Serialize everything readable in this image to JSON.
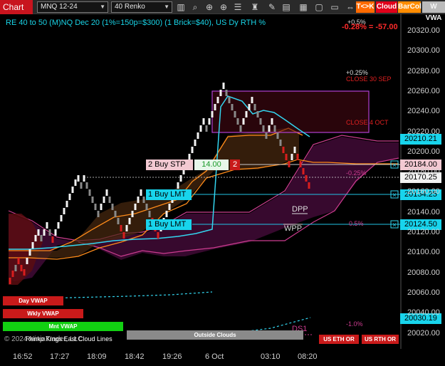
{
  "toolbar": {
    "chart_tab": "Chart",
    "instrument": "MNQ 12-24",
    "bar_type": "40 Renko",
    "icons": [
      "bars-icon",
      "magnify-icon",
      "zoom-icon",
      "properties-icon",
      "strategy-icon",
      "drawing-icon",
      "bar-chart-icon",
      "grid-icon",
      "reload-icon",
      "left-right-icon"
    ],
    "tk_button": "T<>K",
    "cloud_button": "Cloud",
    "barcol_button": "BarCol",
    "wvwa_button": "W VWA",
    "colors": {
      "chart_tab": "#c8141e",
      "tk": "#ff6a00",
      "cloud": "#e0001a",
      "barcol": "#ff8c00",
      "wvwa": "#bbbbbb"
    }
  },
  "chart": {
    "title": "RE 40 to 50 (M)NQ Dec 20 (1%=150p=$300) (1 Brick=$40), US Dy RTH %",
    "pct_top": "+0.5%",
    "change": "-0.28% = -57.00",
    "level_labels": [
      {
        "id": "p025",
        "text": "+0.25%"
      },
      {
        "id": "close30",
        "text": "CLOSE 30 SEP"
      },
      {
        "id": "close4",
        "text": "CLOSE 4 OCT"
      },
      {
        "id": "m025",
        "text": "-0.25%"
      },
      {
        "id": "dpp",
        "text": "DPP"
      },
      {
        "id": "wpp",
        "text": "WPP"
      },
      {
        "id": "p05",
        "text": "0.5%"
      },
      {
        "id": "m10",
        "text": "-1.0%"
      },
      {
        "id": "ds1",
        "text": "DS1"
      }
    ],
    "orders": {
      "buy_stp": {
        "label": "2 Buy STP",
        "price": "14.00",
        "qty": "2"
      },
      "buy_lmt_1": {
        "label": "1 Buy LMT"
      },
      "buy_lmt_2": {
        "label": "1 Buy LMT"
      }
    },
    "price_tags": [
      {
        "id": "t20210",
        "text": "20210.21"
      },
      {
        "id": "t20184",
        "text": "20184.00"
      },
      {
        "id": "t20170",
        "text": "20170.25"
      },
      {
        "id": "t20154",
        "text": "20154.25"
      },
      {
        "id": "t20124",
        "text": "20124.50"
      },
      {
        "id": "t20030",
        "text": "20030.19"
      }
    ],
    "y_axis": [
      "20320.00",
      "20300.00",
      "20280.00",
      "20260.00",
      "20240.00",
      "20220.00",
      "20200.00",
      "20180.00",
      "20160.00",
      "20140.00",
      "20120.00",
      "20100.00",
      "20080.00",
      "20060.00",
      "20040.00",
      "20020.00"
    ],
    "x_axis": [
      "16:52",
      "17:27",
      "18:09",
      "18:42",
      "19:26",
      "6 Oct",
      "03:10",
      "08:20"
    ],
    "legend_bars": {
      "day_vwap": "Day VWAP",
      "wkly_vwap": "Wkly VWAP",
      "mnt_vwap": "Mnt VWAP",
      "outside_clouds": "Outside Clouds",
      "us_eth": "US ETH OR",
      "us_rth": "US RTH OR"
    },
    "copyright": "© 2024 NinjaTrader, LLC",
    "overlay_text": "Renko Kings East Cloud Lines",
    "colors": {
      "title": "#19d3e6",
      "change": "#ff2a2a",
      "cyan": "#33d6f0",
      "magenta": "#cc3c8f",
      "cloud": "#3a0a30",
      "orange": "#ff8c1a"
    }
  }
}
